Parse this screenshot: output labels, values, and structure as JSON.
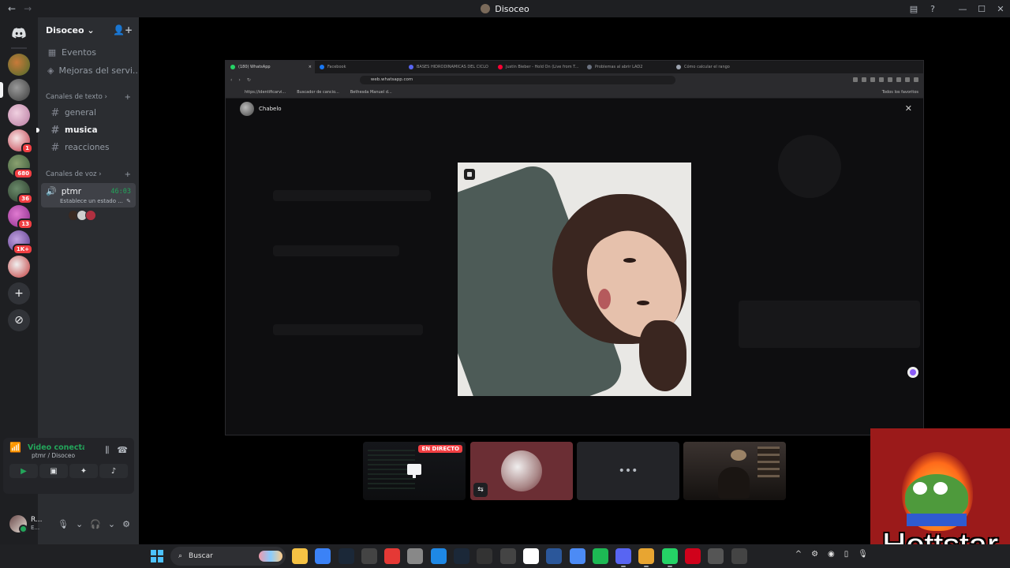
{
  "window": {
    "title": "Disoceo",
    "back": "←",
    "forward": "→",
    "minimize": "—",
    "maximize": "☐",
    "close": "✕"
  },
  "server": {
    "name": "Disoceo"
  },
  "rail": {
    "badges": [
      "1",
      "680",
      "36",
      "13",
      "1K+"
    ],
    "add_label": "+",
    "explore_label": "⊘"
  },
  "sidebar": {
    "events": "Eventos",
    "boosts": "Mejoras del servi...",
    "text_category": "Canales de texto",
    "text_channels": [
      "general",
      "musica",
      "reacciones"
    ],
    "voice_category": "Canales de voz",
    "voice_channel": {
      "name": "ptmr",
      "time": "46:03",
      "status": "Establece un estado ..."
    }
  },
  "rtc": {
    "status": "Video conectado",
    "location": "ptmr / Disoceo"
  },
  "user": {
    "name": "R...",
    "sub": "E..."
  },
  "browser": {
    "tabs": [
      "(180) WhatsApp",
      "Facebook",
      "BASES HIDRODINAMICAS DEL CICLO",
      "Justin Bieber - Hold On (Live from T...",
      "Problemas al abrir LAD2",
      "Cómo calcular el rango"
    ],
    "tab_colors": [
      "#25d366",
      "#1877f2",
      "#5865f2",
      "#ff0033",
      "#6b7280",
      "#9ca3af"
    ],
    "url": "web.whatsapp.com",
    "bookmarks": [
      "https://identificarvi...",
      "Buscador de cancio...",
      "Bethesda Manuel d..."
    ],
    "all_favorites": "Todos los favoritos"
  },
  "whatsapp": {
    "contact": "Chabelo"
  },
  "tiles": {
    "live_badge": "EN DIRECTO",
    "more": "•••"
  },
  "overlay": {
    "label": "Hottstar"
  },
  "taskbar": {
    "search_placeholder": "Buscar",
    "apps": [
      {
        "name": "file-explorer",
        "color": "#f5c244"
      },
      {
        "name": "store",
        "color": "#3b82f6"
      },
      {
        "name": "steam-tray",
        "color": "#1b2838"
      },
      {
        "name": "photo-editor",
        "color": "#444"
      },
      {
        "name": "red-diamond",
        "color": "#e53935"
      },
      {
        "name": "notepad",
        "color": "#888"
      },
      {
        "name": "edge",
        "color": "#1e88e5"
      },
      {
        "name": "steam",
        "color": "#1b2838"
      },
      {
        "name": "nvidia",
        "color": "#333"
      },
      {
        "name": "calendar",
        "color": "#444"
      },
      {
        "name": "notion",
        "color": "#fff"
      },
      {
        "name": "word",
        "color": "#2b579a"
      },
      {
        "name": "vivaldi",
        "color": "#4c8bf5"
      },
      {
        "name": "spotify",
        "color": "#1db954"
      },
      {
        "name": "discord",
        "color": "#5865f2"
      },
      {
        "name": "chrome",
        "color": "#e8a531"
      },
      {
        "name": "whatsapp",
        "color": "#25d366"
      },
      {
        "name": "opera",
        "color": "#d0021b"
      },
      {
        "name": "app-red",
        "color": "#555"
      },
      {
        "name": "steam-2",
        "color": "#444"
      }
    ]
  },
  "colors": {
    "discord_green": "#23a55a",
    "live_red": "#f23f43",
    "badge_red": "#f23f43"
  }
}
